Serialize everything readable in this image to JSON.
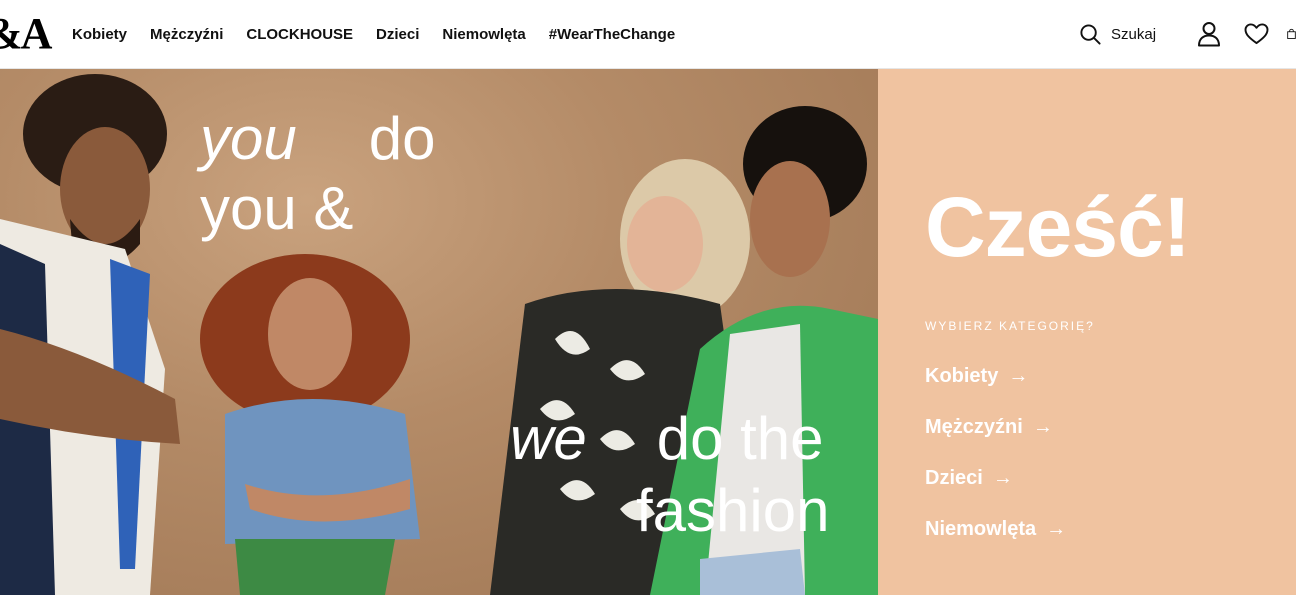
{
  "header": {
    "logo": "&A",
    "nav": [
      "Kobiety",
      "Mężczyźni",
      "CLOCKHOUSE",
      "Dzieci",
      "Niemowlęta",
      "#WearTheChange"
    ],
    "search_label": "Szukaj"
  },
  "hero": {
    "slogan_1": {
      "word_a": "you",
      "word_b": "do",
      "line2": "you &"
    },
    "slogan_2": {
      "word_a": "we",
      "word_b": "do the",
      "line2": "fashion"
    }
  },
  "panel": {
    "greeting": "Cześć!",
    "choose_label": "WYBIERZ KATEGORIĘ?",
    "categories": [
      "Kobiety",
      "Mężczyźni",
      "Dzieci",
      "Niemowlęta"
    ],
    "arrow": "→",
    "background": "#f0c3a0"
  },
  "icons": [
    "search-icon",
    "account-icon",
    "heart-icon",
    "bag-icon"
  ]
}
